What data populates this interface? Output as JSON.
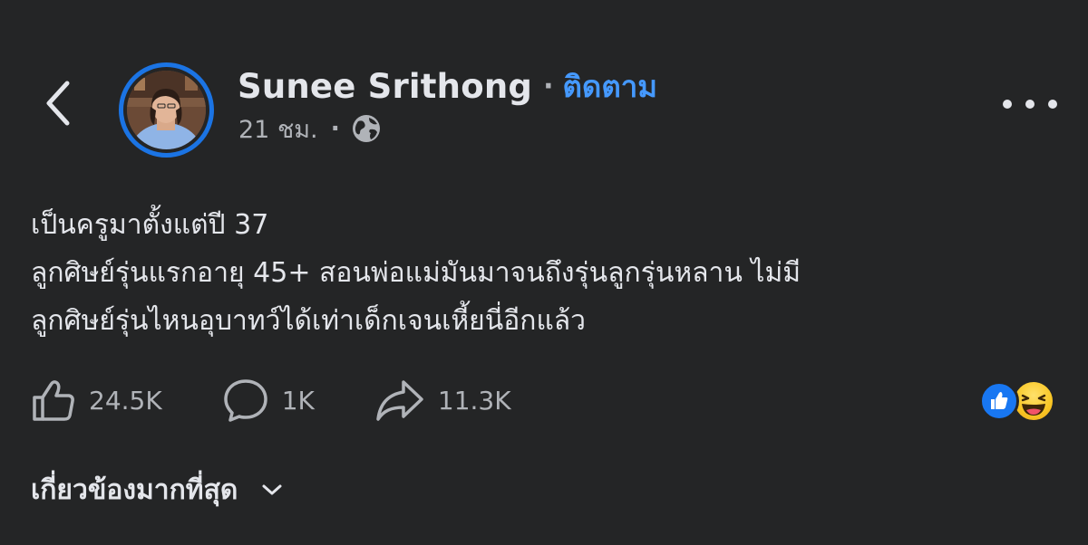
{
  "header": {
    "back_icon": "chevron-left-icon",
    "author_name": "Sunee Srithong",
    "separator": "·",
    "follow_label": "ติดตาม",
    "timestamp": "21 ชม.",
    "meta_separator": "·",
    "privacy_icon": "globe-icon",
    "more_icon": "more-horizontal-icon"
  },
  "post": {
    "lines": [
      "เป็นครูมาตั้งแต่ปี 37",
      "ลูกศิษย์รุ่นแรกอายุ 45+ สอนพ่อแม่มันมาจนถึงรุ่นลูกรุ่นหลาน ไม่มี",
      "ลูกศิษย์รุ่นไหนอุบาทว์ได้เท่าเด็กเจนเหี้ยนี่อีกแล้ว"
    ]
  },
  "actions": {
    "like": {
      "icon": "thumbs-up-icon",
      "count": "24.5K"
    },
    "comment": {
      "icon": "comment-icon",
      "count": "1K"
    },
    "share": {
      "icon": "share-icon",
      "count": "11.3K"
    }
  },
  "reactions": [
    "like-reaction-icon",
    "haha-reaction-icon"
  ],
  "comments_filter": {
    "label": "เกี่ยวข้องมากที่สุด",
    "icon": "chevron-down-icon"
  },
  "colors": {
    "background": "#242526",
    "text_primary": "#e4e6eb",
    "text_secondary": "#b0b3b8",
    "accent": "#4599ff",
    "avatar_ring": "#1b74e4",
    "like_blue": "#1877f2"
  }
}
